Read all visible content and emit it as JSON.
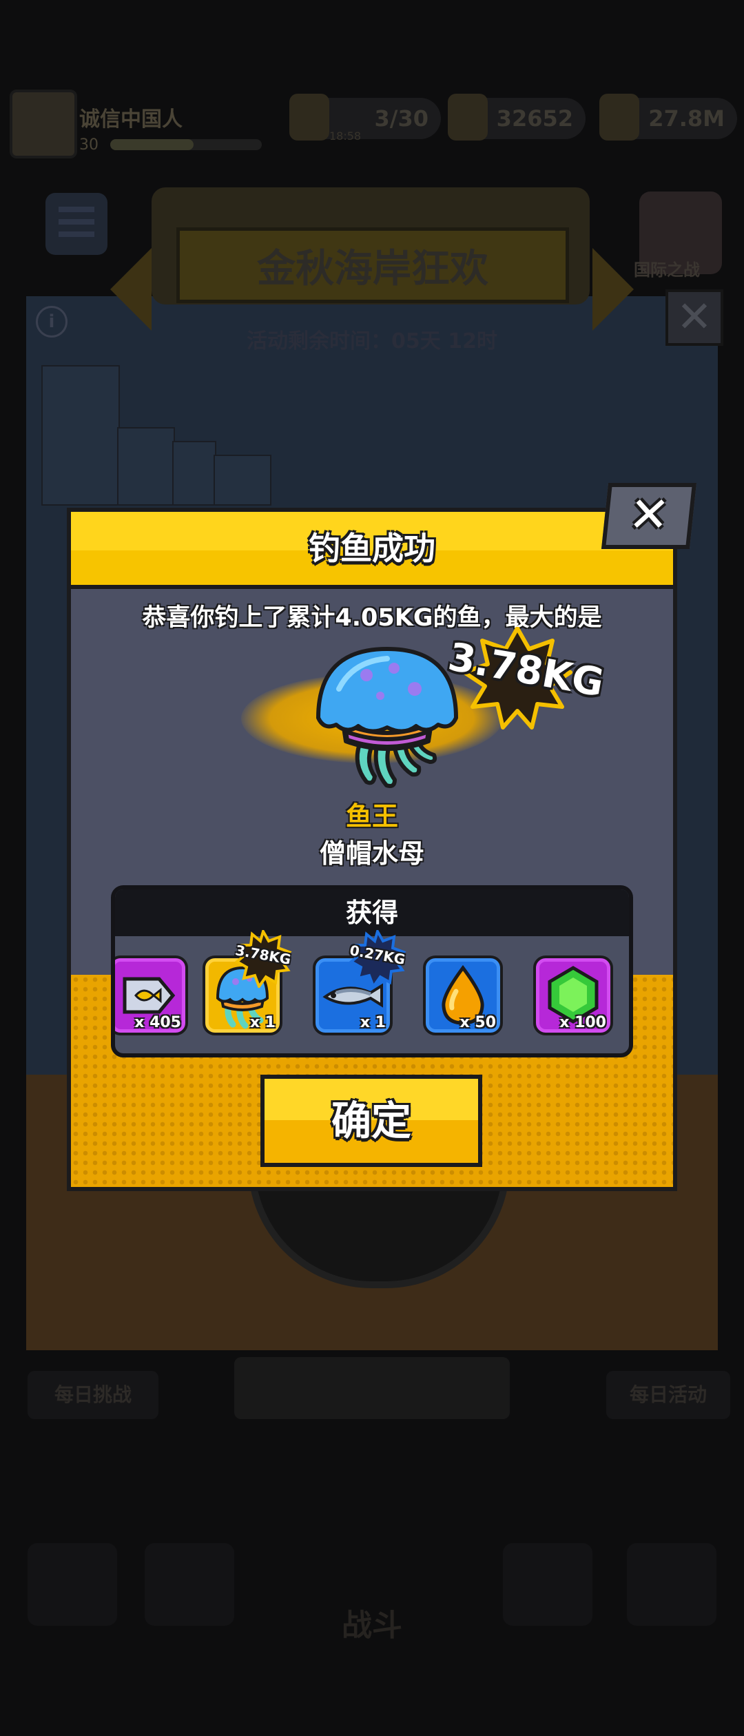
{
  "background": {
    "player_name": "诚信中国人",
    "player_level": "30",
    "resources": {
      "energy": "3/30",
      "energy_sub": "18:58",
      "coins": "32652",
      "cash": "27.8M"
    },
    "event_title": "金秋海岸狂欢",
    "event_timer": "活动剩余时间：05天 12时",
    "shield_label": "国际之战",
    "tabs": {
      "left": "每日挑战",
      "right": "每日活动"
    },
    "nav_battle": "战斗"
  },
  "modal": {
    "title": "钓鱼成功",
    "congrats": "恭喜你钓上了累计4.05KG的鱼，最大的是",
    "biggest_weight": "3.78KG",
    "fish_rank": "鱼王",
    "fish_name": "僧帽水母",
    "rewards_header": "获得",
    "rewards": [
      {
        "icon": "fish-ticket-icon",
        "qty": "x 405"
      },
      {
        "icon": "jellyfish-icon",
        "qty": "x 1",
        "badge": "3.78KG"
      },
      {
        "icon": "sardine-icon",
        "qty": "x 1",
        "badge": "0.27KG"
      },
      {
        "icon": "oil-drop-icon",
        "qty": "x 50"
      },
      {
        "icon": "green-gem-icon",
        "qty": "x 100"
      }
    ],
    "confirm_label": "确定",
    "close_symbol": "✕"
  },
  "colors": {
    "modal_gold": "#f7c400",
    "modal_body": "#4c5064",
    "rank_gold": "#f5c000",
    "reward_purple": "#b628d8",
    "reward_gold": "#f2b800",
    "reward_blue": "#1b6fe0"
  }
}
